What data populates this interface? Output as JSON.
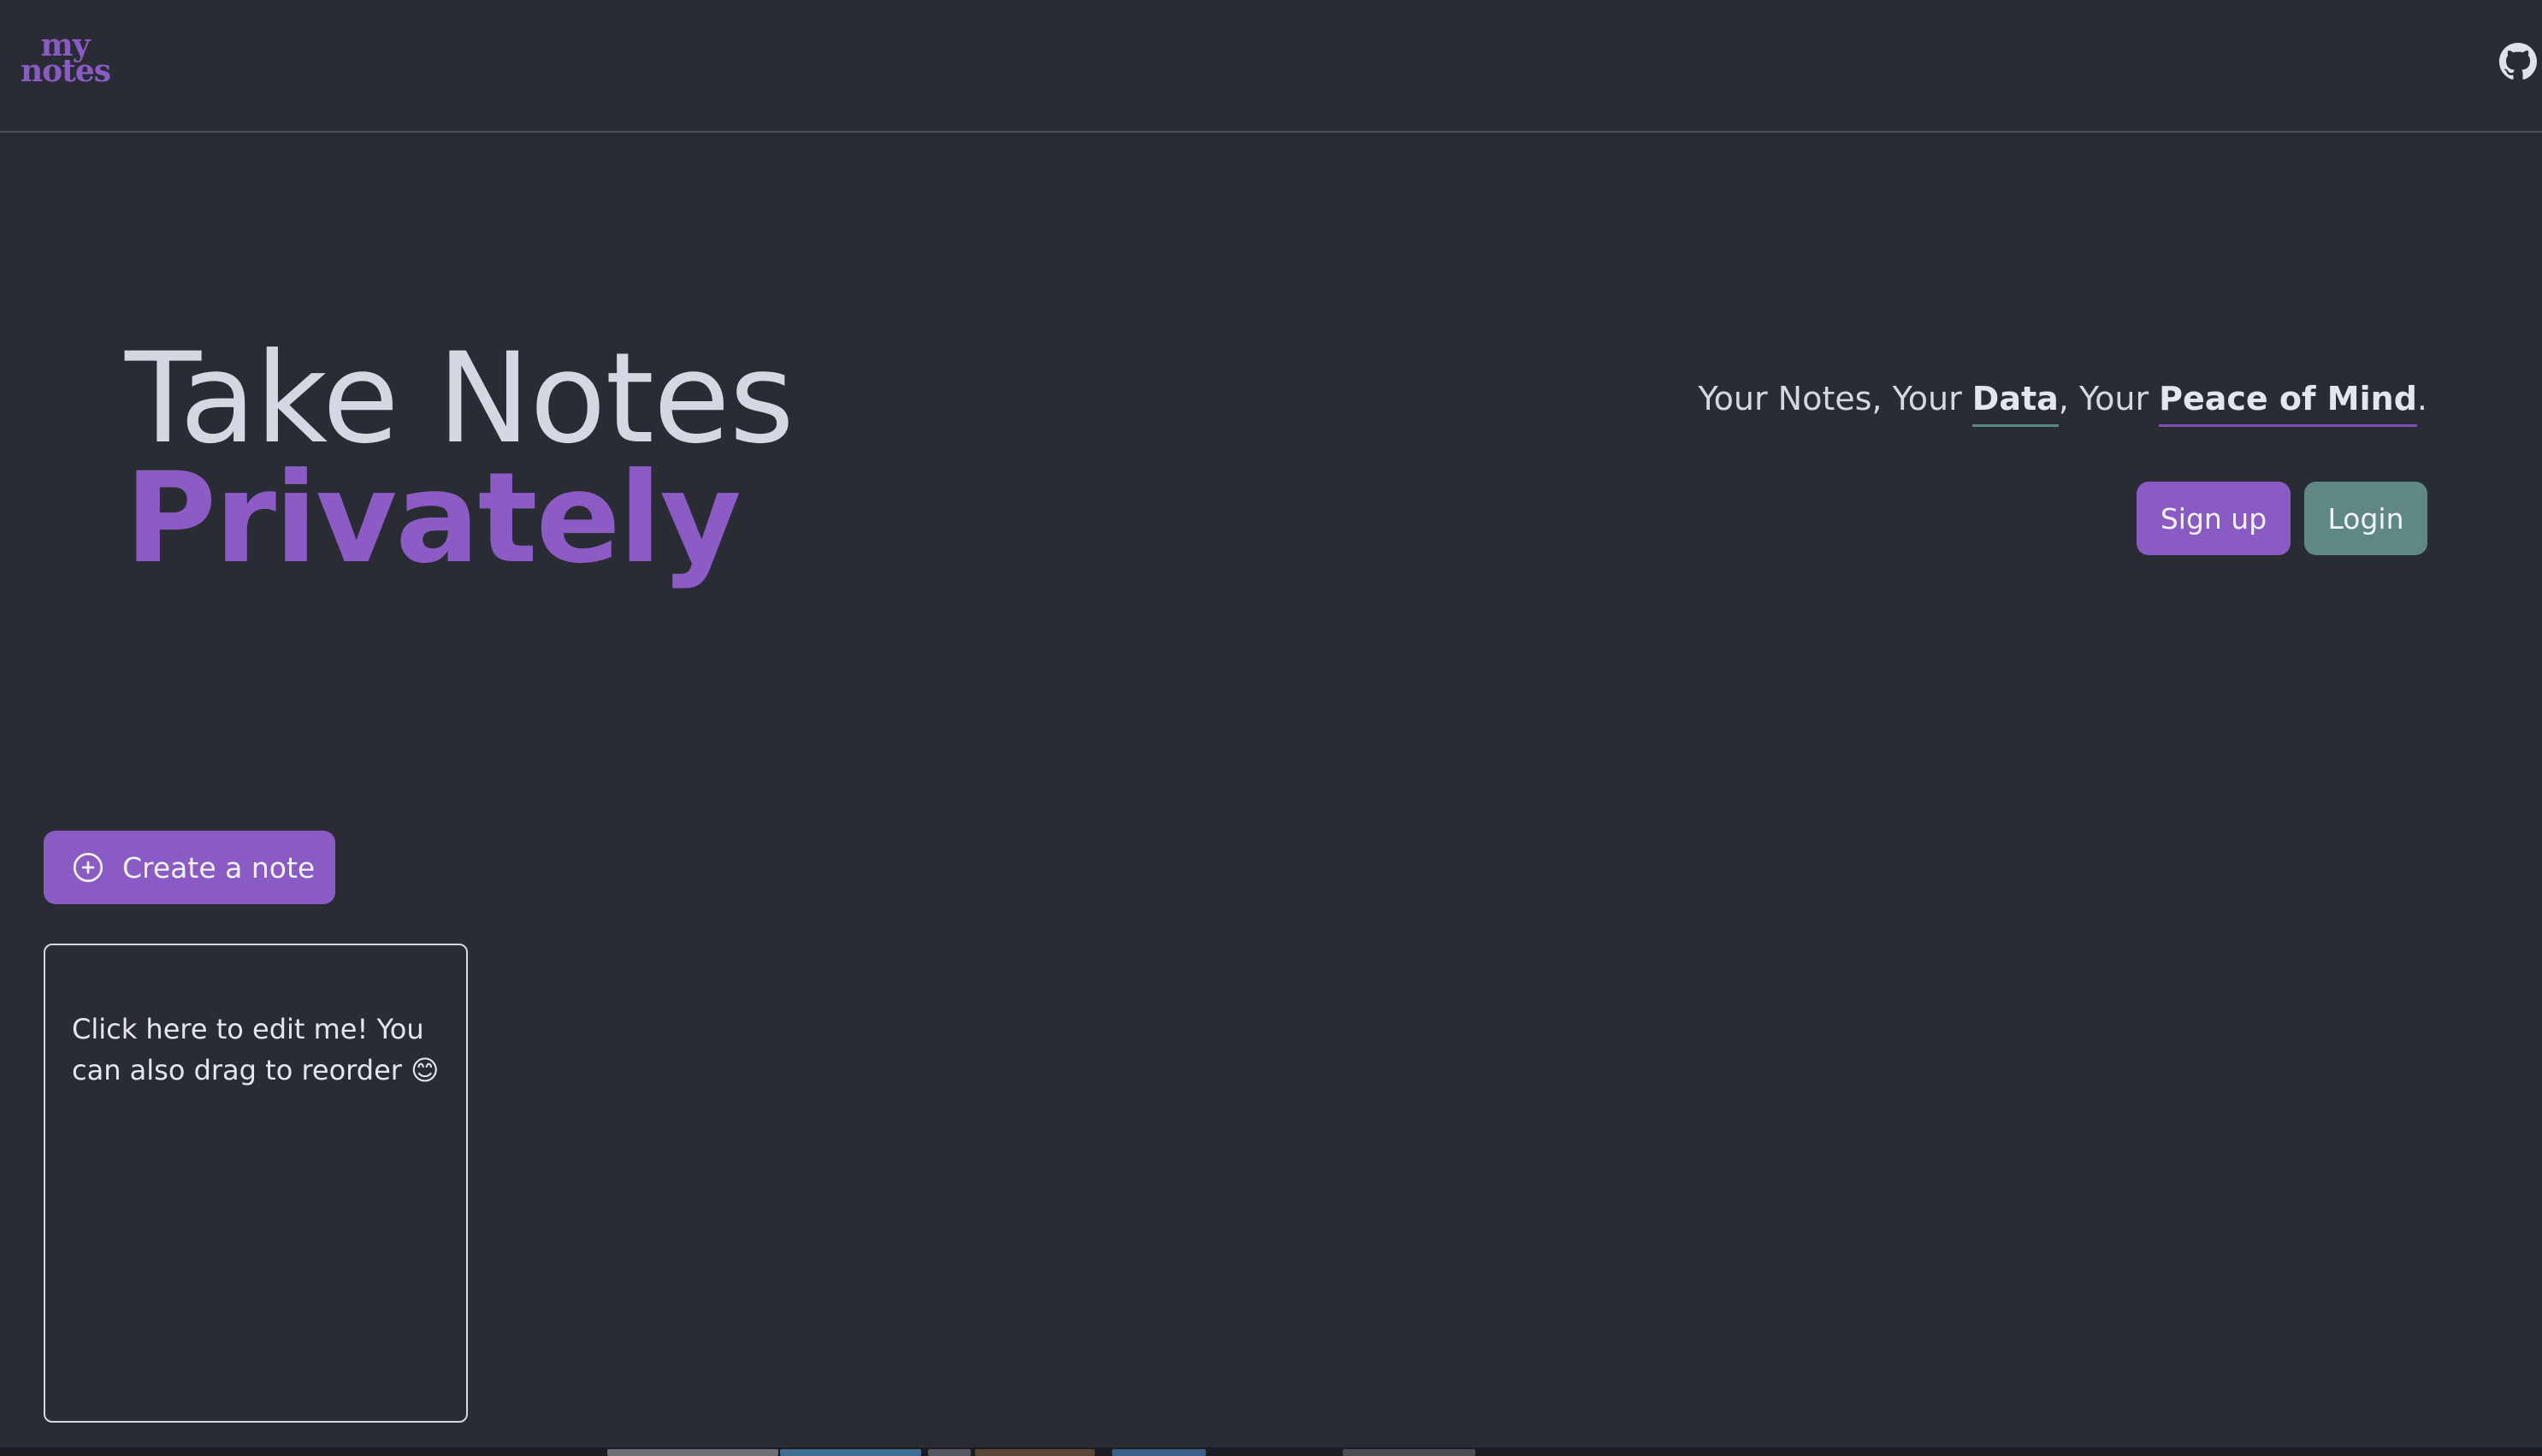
{
  "header": {
    "logo_line1": "my",
    "logo_line2": "notes",
    "github_icon": "github-icon"
  },
  "hero": {
    "title_line1": "Take Notes",
    "title_line2": "Privately",
    "tagline_part1": "Your Notes, Your ",
    "tagline_bold1": "Data",
    "tagline_part2": ", Your ",
    "tagline_bold2": "Peace of Mind",
    "tagline_part3": "."
  },
  "auth": {
    "signup_label": "Sign up",
    "login_label": "Login"
  },
  "notes": {
    "create_label": "Create a note",
    "create_icon": "plus-circle-icon",
    "items": [
      {
        "text": "Click here to edit me! You can also drag to reorder 😊"
      }
    ]
  },
  "colors": {
    "background": "#2a2c33",
    "accent_purple": "#8a5bc4",
    "accent_teal": "#5f8783",
    "text": "#d3d8e2"
  }
}
